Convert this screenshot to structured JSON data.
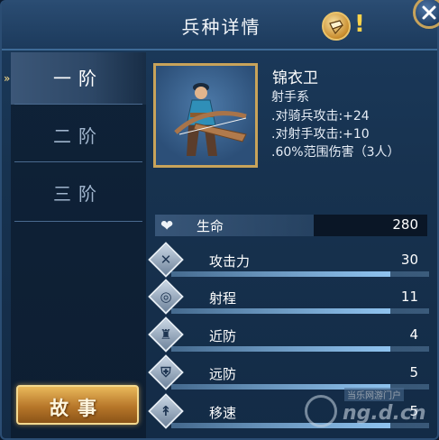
{
  "window": {
    "title": "兵种详情"
  },
  "header": {
    "info_icon": "scroll-badge-icon",
    "alert_mark": "!",
    "close_icon": "close-icon"
  },
  "tiers": [
    {
      "label": "一阶",
      "active": true
    },
    {
      "label": "二阶",
      "active": false
    },
    {
      "label": "三阶",
      "active": false
    }
  ],
  "story_button": {
    "label": "故事"
  },
  "unit": {
    "name": "锦衣卫",
    "class": "射手系",
    "traits": [
      ".对骑兵攻击:+24",
      ".对射手攻击:+10",
      ".60%范围伤害（3人）"
    ]
  },
  "health": {
    "label": "生命",
    "value": "280",
    "icon": "heart-icon"
  },
  "stats": [
    {
      "label": "攻击力",
      "value": "30",
      "icon": "crossed-swords-icon",
      "fill": 0.85
    },
    {
      "label": "射程",
      "value": "11",
      "icon": "target-icon",
      "fill": 0.85
    },
    {
      "label": "近防",
      "value": "4",
      "icon": "armor-icon",
      "fill": 0.85
    },
    {
      "label": "远防",
      "value": "5",
      "icon": "shield-icon",
      "fill": 0.85
    },
    {
      "label": "移速",
      "value": "5",
      "icon": "boot-icon",
      "fill": 0.85
    }
  ],
  "watermark": {
    "top": "当乐网游门户",
    "text": "ng.d.cn"
  }
}
